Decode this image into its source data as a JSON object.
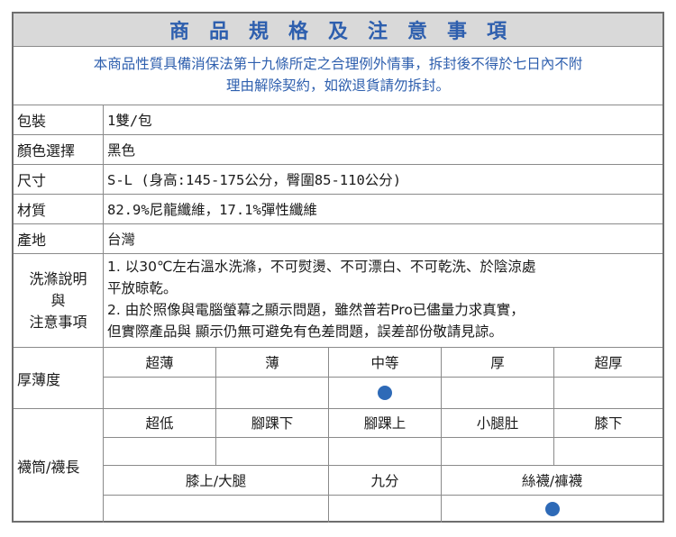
{
  "title": "商品規格及注意事項",
  "notice_line1": "本商品性質具備消保法第十九條所定之合理例外情事，拆封後不得於七日內不附",
  "notice_line2": "理由解除契約，如欲退貨請勿拆封。",
  "specs": [
    {
      "label": "包裝",
      "value": "1雙/包"
    },
    {
      "label": "顏色選擇",
      "value": "黑色"
    },
    {
      "label": "尺寸",
      "value": "S-L (身高:145-175公分，臀圍85-110公分)"
    },
    {
      "label": "材質",
      "value": "82.9%尼龍纖維，17.1%彈性纖維"
    },
    {
      "label": "產地",
      "value": "台灣"
    }
  ],
  "care": {
    "label_line1": "洗滌說明",
    "label_line2": "與",
    "label_line3": "注意事項",
    "line1": "1. 以30℃左右溫水洗滌，不可熨燙、不可漂白、不可乾洗、於陰涼處",
    "line2": "平放晾乾。",
    "line3": "2. 由於照像與電腦螢幕之顯示問題，雖然普若Pro已儘量力求真實，",
    "line4": "但實際產品與 顯示仍無可避免有色差問題，誤差部份敬請見諒。"
  },
  "thickness": {
    "label": "厚薄度",
    "options": [
      "超薄",
      "薄",
      "中等",
      "厚",
      "超厚"
    ],
    "selected": "中等"
  },
  "length": {
    "label": "襪筒/襪長",
    "options_row1": [
      "超低",
      "腳踝下",
      "腳踝上",
      "小腿肚",
      "膝下"
    ],
    "options_row2": [
      "膝上/大腿",
      "九分",
      "絲襪/褲襪"
    ],
    "selected": "絲襪/褲襪"
  },
  "colors": {
    "accent": "#2e5fae",
    "dot": "#2e6ab7",
    "title_bg": "#d9d9d9",
    "border": "#8a8a8a"
  }
}
